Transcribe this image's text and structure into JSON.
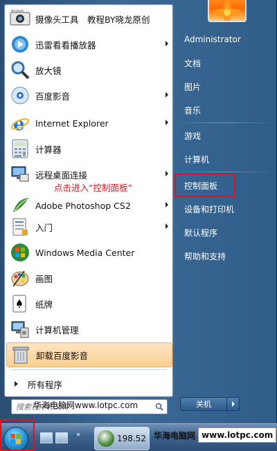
{
  "programs": [
    {
      "label": "摄像头工具　教程BY晓龙原创",
      "icon": "camera-icon",
      "submenu": false
    },
    {
      "label": "迅雷看看播放器",
      "icon": "xunlei-player-icon",
      "submenu": true
    },
    {
      "label": "放大镜",
      "icon": "magnifier-icon",
      "submenu": false
    },
    {
      "label": "百度影音",
      "icon": "baidu-player-icon",
      "submenu": true
    },
    {
      "label": "Internet Explorer",
      "icon": "ie-icon",
      "submenu": true
    },
    {
      "label": "计算器",
      "icon": "calculator-icon",
      "submenu": false
    },
    {
      "label": "远程桌面连接",
      "icon": "remote-desktop-icon",
      "submenu": true
    },
    {
      "label": "Adobe Photoshop CS2",
      "icon": "photoshop-icon",
      "submenu": true
    },
    {
      "label": "入门",
      "icon": "getting-started-icon",
      "submenu": true
    },
    {
      "label": "Windows Media Center",
      "icon": "media-center-icon",
      "submenu": false
    },
    {
      "label": "画图",
      "icon": "paint-icon",
      "submenu": false
    },
    {
      "label": "纸牌",
      "icon": "solitaire-icon",
      "submenu": false
    },
    {
      "label": "计算机管理",
      "icon": "computer-management-icon",
      "submenu": false
    },
    {
      "label": "卸载百度影音",
      "icon": "recycle-bin-icon",
      "submenu": false
    }
  ],
  "all_programs": "所有程序",
  "search": {
    "placeholder": "搜索程序和文件",
    "overlay": "华海电脑网www.lotpc.com"
  },
  "right_items": [
    {
      "label": "Administrator"
    },
    {
      "label": "文档"
    },
    {
      "label": "图片"
    },
    {
      "label": "音乐"
    },
    {
      "label": "游戏"
    },
    {
      "label": "计算机"
    },
    {
      "label": "控制面板"
    },
    {
      "label": "设备和打印机"
    },
    {
      "label": "默认程序"
    },
    {
      "label": "帮助和支持"
    }
  ],
  "annotation": "点击进入“控制面板”",
  "shutdown": {
    "label": "关机"
  },
  "taskbar": {
    "app_label": "198.52",
    "watermark_cn": "华海电脑网",
    "watermark_url": "www.lotpc.com"
  },
  "colors": {
    "highlight_red": "#e0141c",
    "menu_blue": "#2f5c88",
    "selected_item": "#fccf93"
  }
}
